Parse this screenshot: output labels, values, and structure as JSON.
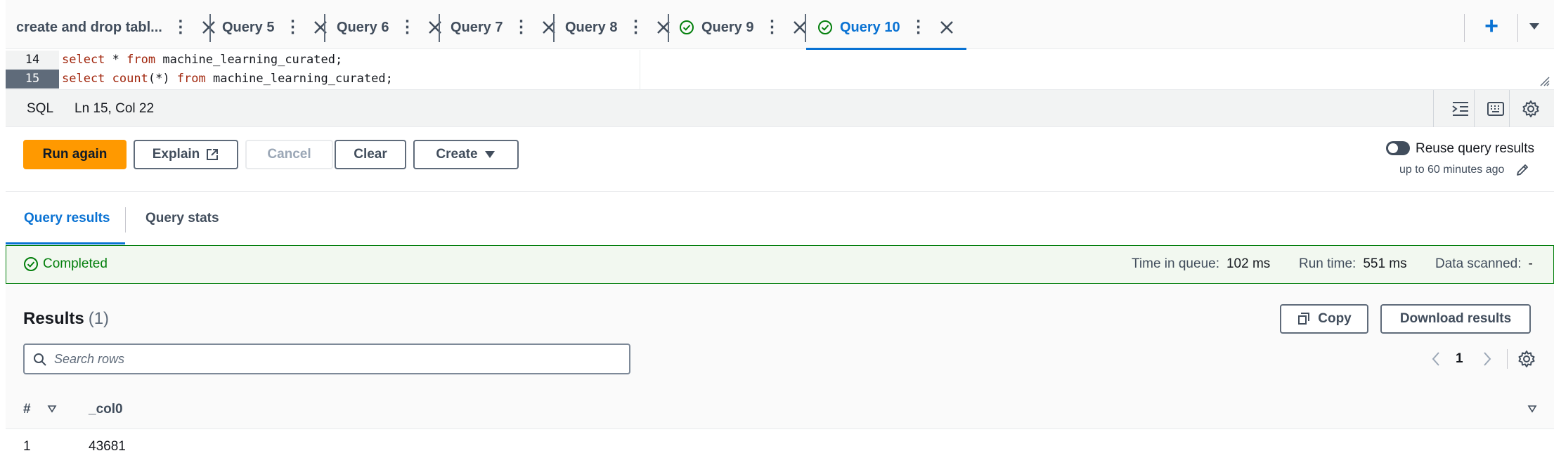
{
  "tabs": [
    {
      "label": "create and drop tabl...",
      "active": false,
      "completed": false
    },
    {
      "label": "Query 5",
      "active": false,
      "completed": false
    },
    {
      "label": "Query 6",
      "active": false,
      "completed": false
    },
    {
      "label": "Query 7",
      "active": false,
      "completed": false
    },
    {
      "label": "Query 8",
      "active": false,
      "completed": false
    },
    {
      "label": "Query 9",
      "active": false,
      "completed": true
    },
    {
      "label": "Query 10",
      "active": true,
      "completed": true
    }
  ],
  "tab_actions": {
    "more_icon": "more-vertical-icon",
    "close_icon": "close-icon",
    "add_icon": "add-plus-icon",
    "menu_icon": "caret-down-icon"
  },
  "editor": {
    "lines": [
      {
        "number": "14",
        "kw1": "select",
        "mid": " * ",
        "kw2": "from",
        "rest": " machine_learning_curated;"
      },
      {
        "number": "15",
        "kw1": "select",
        "fn": " count",
        "mid": "(*) ",
        "kw2": "from",
        "rest": " machine_learning_curated;"
      }
    ]
  },
  "status": {
    "language": "SQL",
    "cursor": "Ln 15, Col 22"
  },
  "actions": {
    "run": "Run again",
    "explain": "Explain",
    "cancel": "Cancel",
    "clear": "Clear",
    "create": "Create",
    "reuse_label": "Reuse query results",
    "reuse_sub": "up to 60 minutes ago",
    "reuse_enabled": false
  },
  "result_tabs": {
    "results": "Query results",
    "stats": "Query stats"
  },
  "completion": {
    "status": "Completed",
    "queue_label": "Time in queue:",
    "queue_value": "102 ms",
    "run_label": "Run time:",
    "run_value": "551 ms",
    "scanned_label": "Data scanned:",
    "scanned_value": "-"
  },
  "results": {
    "title": "Results",
    "count": "(1)",
    "copy": "Copy",
    "download": "Download results",
    "search_placeholder": "Search rows",
    "page": "1",
    "columns": [
      "#",
      "_col0"
    ],
    "rows": [
      [
        "1",
        "43681"
      ]
    ]
  },
  "colors": {
    "accent": "#0972d3",
    "primary_button": "#ff9900",
    "success": "#037f0c"
  }
}
